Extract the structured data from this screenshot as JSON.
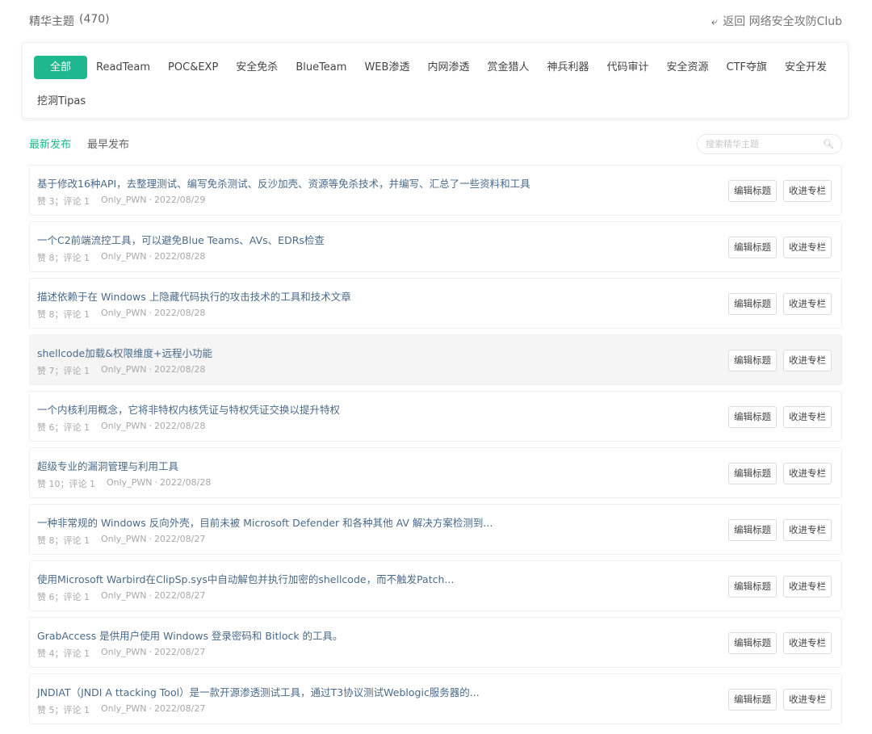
{
  "header": {
    "title": "精华主题",
    "count": "(470)",
    "back_icon": "return-arrow-icon",
    "back_label": "返回 网络安全攻防Club"
  },
  "categories": {
    "row1": [
      "全部",
      "ReadTeam",
      "POC&EXP",
      "安全免杀",
      "BlueTeam",
      "WEB渗透",
      "内网渗透",
      "赏金猎人",
      "神兵利器",
      "代码审计",
      "安全资源",
      "CTF夺旗",
      "安全开发"
    ],
    "row2": [
      "挖洞Tipas"
    ],
    "active": "全部"
  },
  "sort": {
    "newest": "最新发布",
    "oldest": "最早发布"
  },
  "search": {
    "placeholder": "搜索精华主题",
    "icon": "search-icon"
  },
  "actions": {
    "edit_title": "编辑标题",
    "add_to_column": "收进专栏"
  },
  "topics": [
    {
      "title": "基于修改16种API，去整理测试、编写免杀测试、反沙加壳、资源等免杀技术，并编写、汇总了一些资料和工具",
      "likes": "赞 3",
      "comments": "评论 1",
      "author": "Only_PWN",
      "date": "2022/08/29"
    },
    {
      "title": "一个C2前端流控工具，可以避免Blue Teams、AVs、EDRs检查",
      "likes": "赞 8",
      "comments": "评论 1",
      "author": "Only_PWN",
      "date": "2022/08/28"
    },
    {
      "title": "描述依赖于在 Windows 上隐藏代码执行的攻击技术的工具和技术文章",
      "likes": "赞 8",
      "comments": "评论 1",
      "author": "Only_PWN",
      "date": "2022/08/28"
    },
    {
      "title": "shellcode加载&权限维度+远程小功能",
      "likes": "赞 7",
      "comments": "评论 1",
      "author": "Only_PWN",
      "date": "2022/08/28"
    },
    {
      "title": "一个内核利用概念，它将非特权内核凭证与特权凭证交换以提升特权",
      "likes": "赞 6",
      "comments": "评论 1",
      "author": "Only_PWN",
      "date": "2022/08/28"
    },
    {
      "title": "超级专业的漏洞管理与利用工具",
      "likes": "赞 10",
      "comments": "评论 1",
      "author": "Only_PWN",
      "date": "2022/08/28"
    },
    {
      "title": "一种非常规的 Windows 反向外壳，目前未被 Microsoft Defender 和各种其他 AV 解决方案检测到...",
      "likes": "赞 8",
      "comments": "评论 1",
      "author": "Only_PWN",
      "date": "2022/08/27"
    },
    {
      "title": "使用Microsoft Warbird在ClipSp.sys中自动解包并执行加密的shellcode，而不触发Patch...",
      "likes": "赞 6",
      "comments": "评论 1",
      "author": "Only_PWN",
      "date": "2022/08/27"
    },
    {
      "title": "GrabAccess 是供用户使用 Windows 登录密码和 Bitlock 的工具。",
      "likes": "赞 4",
      "comments": "评论 1",
      "author": "Only_PWN",
      "date": "2022/08/27"
    },
    {
      "title": "JNDIAT（JNDI A ttacking Tool）是一款开源渗透测试工具，通过T3协议测试Weblogic服务器的...",
      "likes": "赞 5",
      "comments": "评论 1",
      "author": "Only_PWN",
      "date": "2022/08/27"
    }
  ]
}
